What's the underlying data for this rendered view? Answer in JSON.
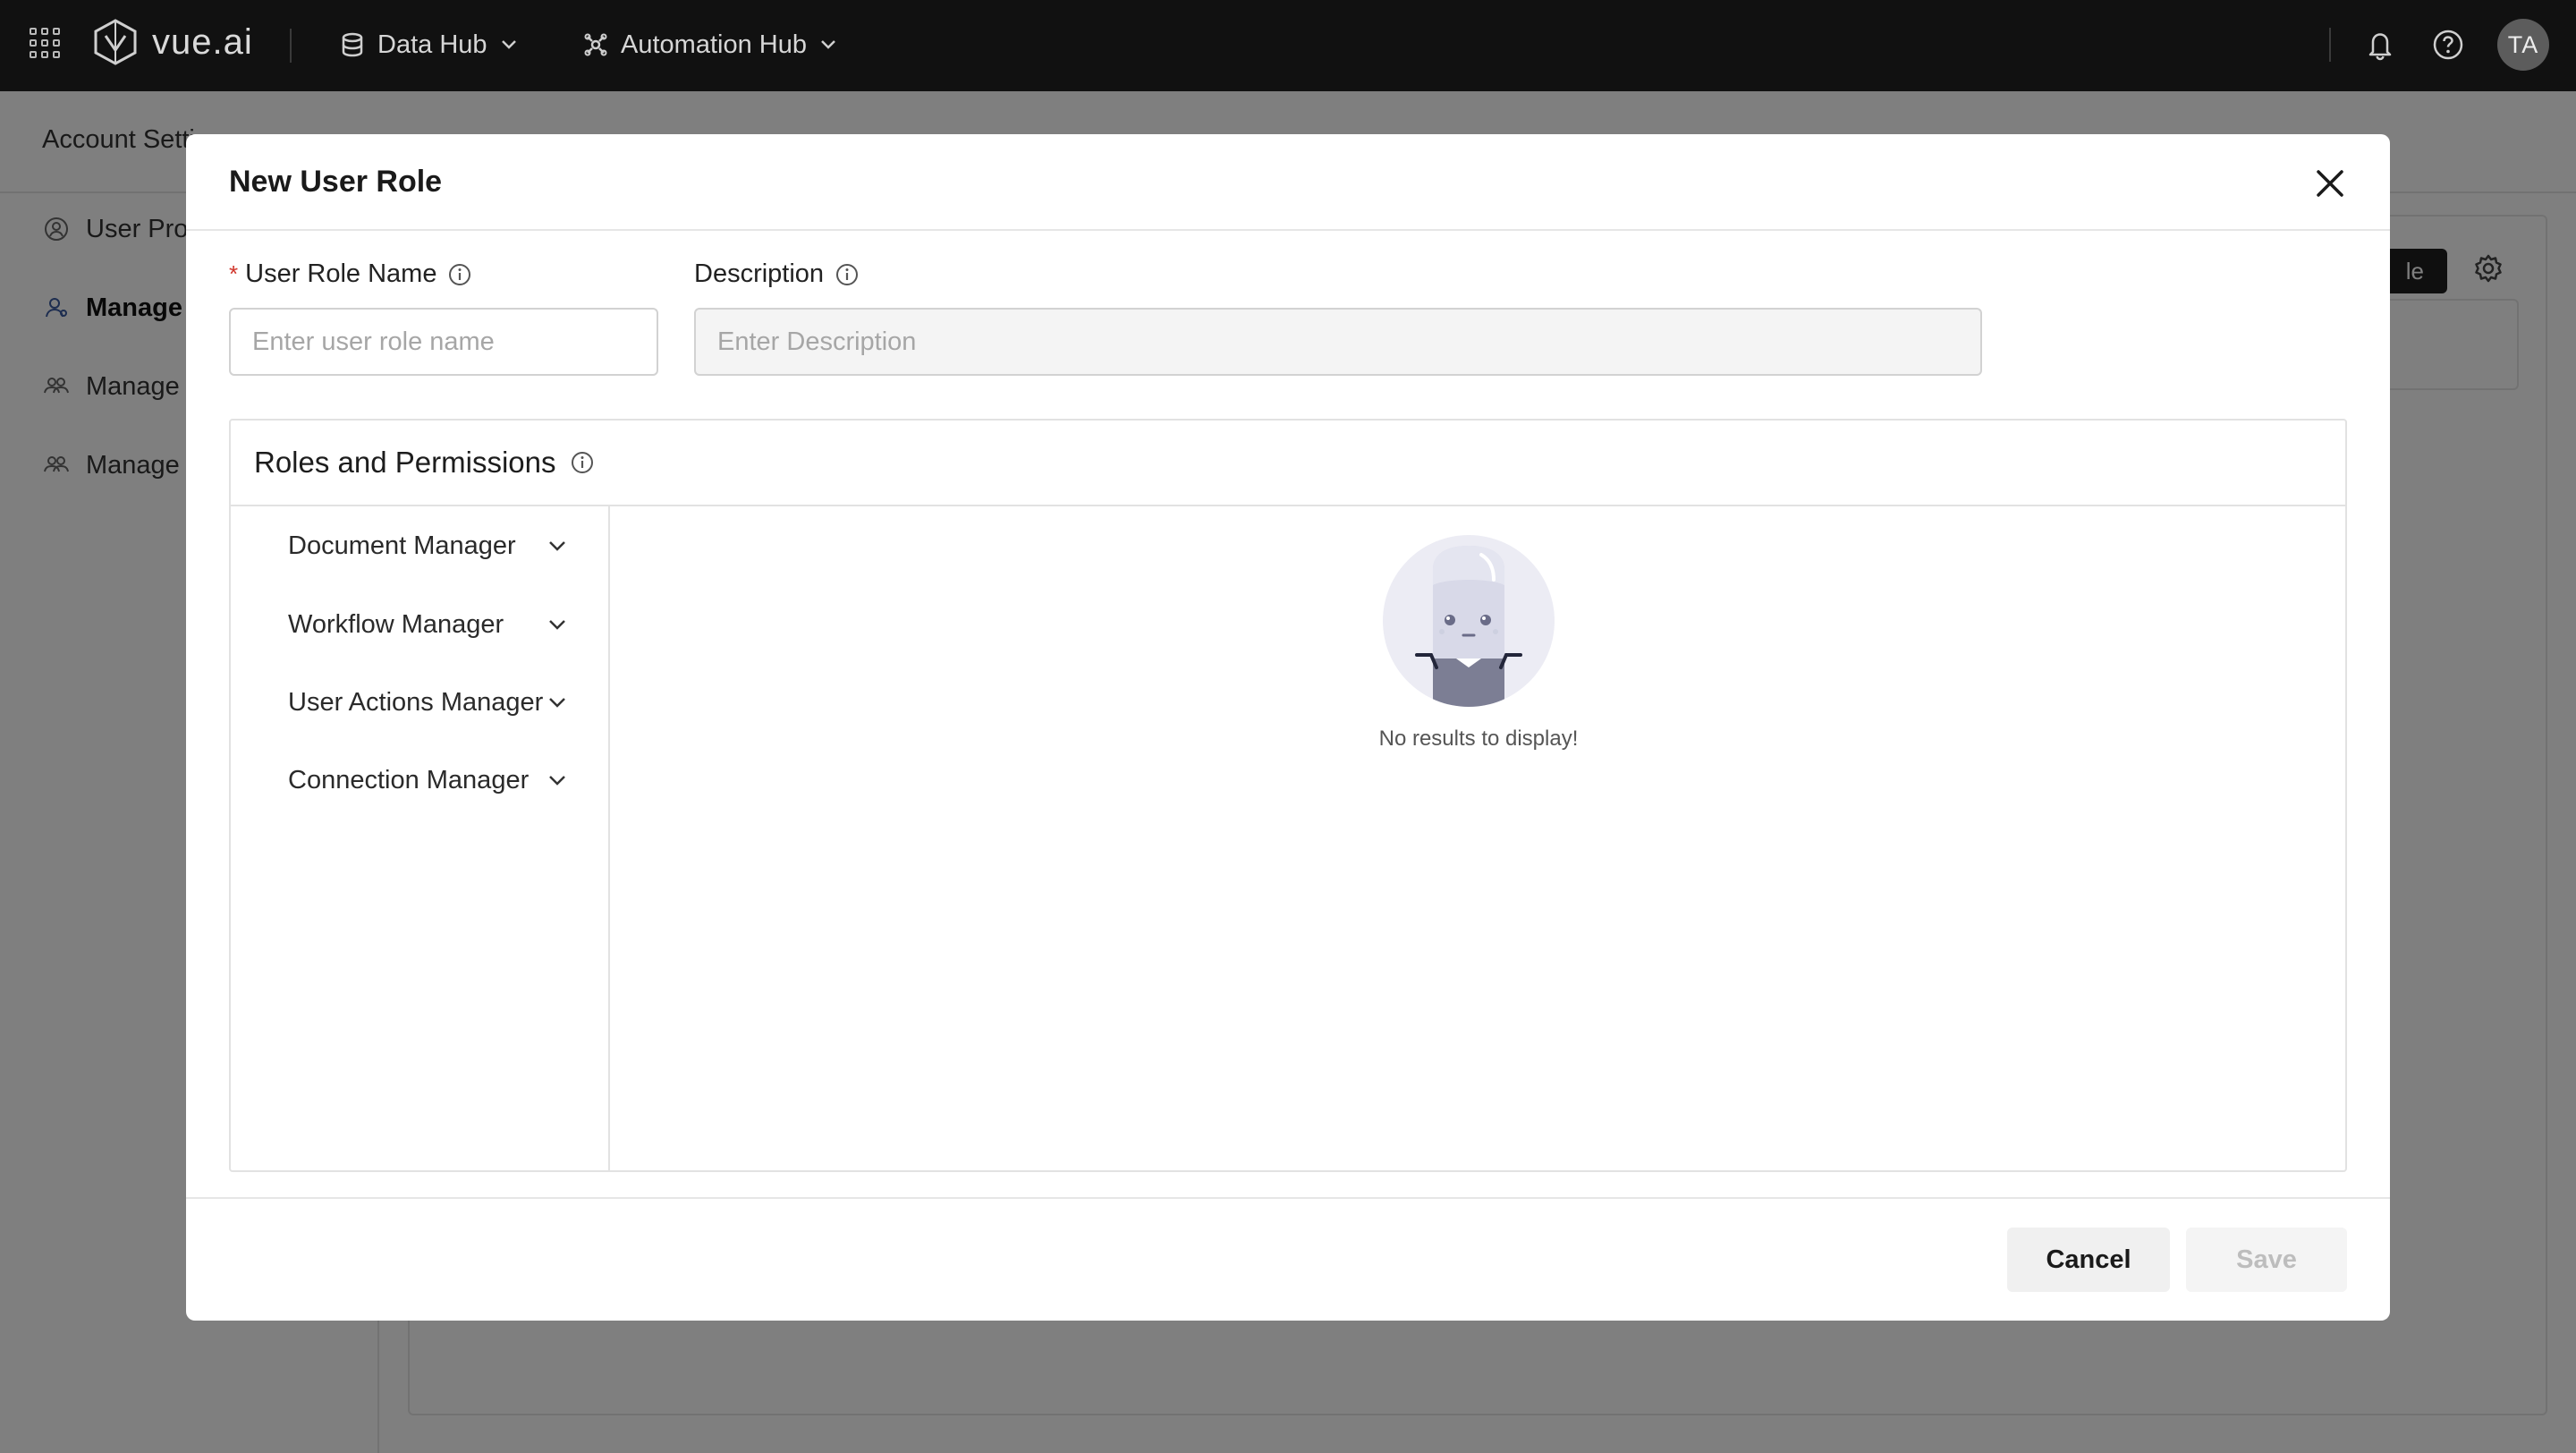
{
  "topbar": {
    "brand": "vue.ai",
    "nav": [
      {
        "label": "Data Hub",
        "icon": "database-icon"
      },
      {
        "label": "Automation Hub",
        "icon": "automation-icon"
      }
    ],
    "user_initials": "TA"
  },
  "background": {
    "section_title": "Account Setti",
    "sidebar": [
      {
        "label": "User Prof",
        "icon": "user-circle-icon"
      },
      {
        "label": "Manage U",
        "icon": "user-icon"
      },
      {
        "label": "Manage U",
        "icon": "users-icon"
      },
      {
        "label": "Manage U",
        "icon": "users-icon"
      }
    ],
    "action_button_label": "le"
  },
  "modal": {
    "title": "New User Role",
    "role_name": {
      "required_mark": "*",
      "label": "User Role Name",
      "placeholder": "Enter user role name",
      "value": ""
    },
    "description": {
      "label": "Description",
      "placeholder": "Enter Description",
      "value": ""
    },
    "permissions": {
      "title": "Roles and Permissions",
      "groups": [
        {
          "label": "Document Manager"
        },
        {
          "label": "Workflow Manager"
        },
        {
          "label": "User Actions Manager"
        },
        {
          "label": "Connection Manager"
        }
      ],
      "empty_message": "No results to display!"
    },
    "footer": {
      "cancel_label": "Cancel",
      "save_label": "Save"
    }
  },
  "colors": {
    "topbar_bg": "#111111",
    "overlay": "rgba(0,0,0,0.5)",
    "required": "#d0352b",
    "illustration_bg": "#ececf4",
    "robot_body": "#7c7e94"
  }
}
